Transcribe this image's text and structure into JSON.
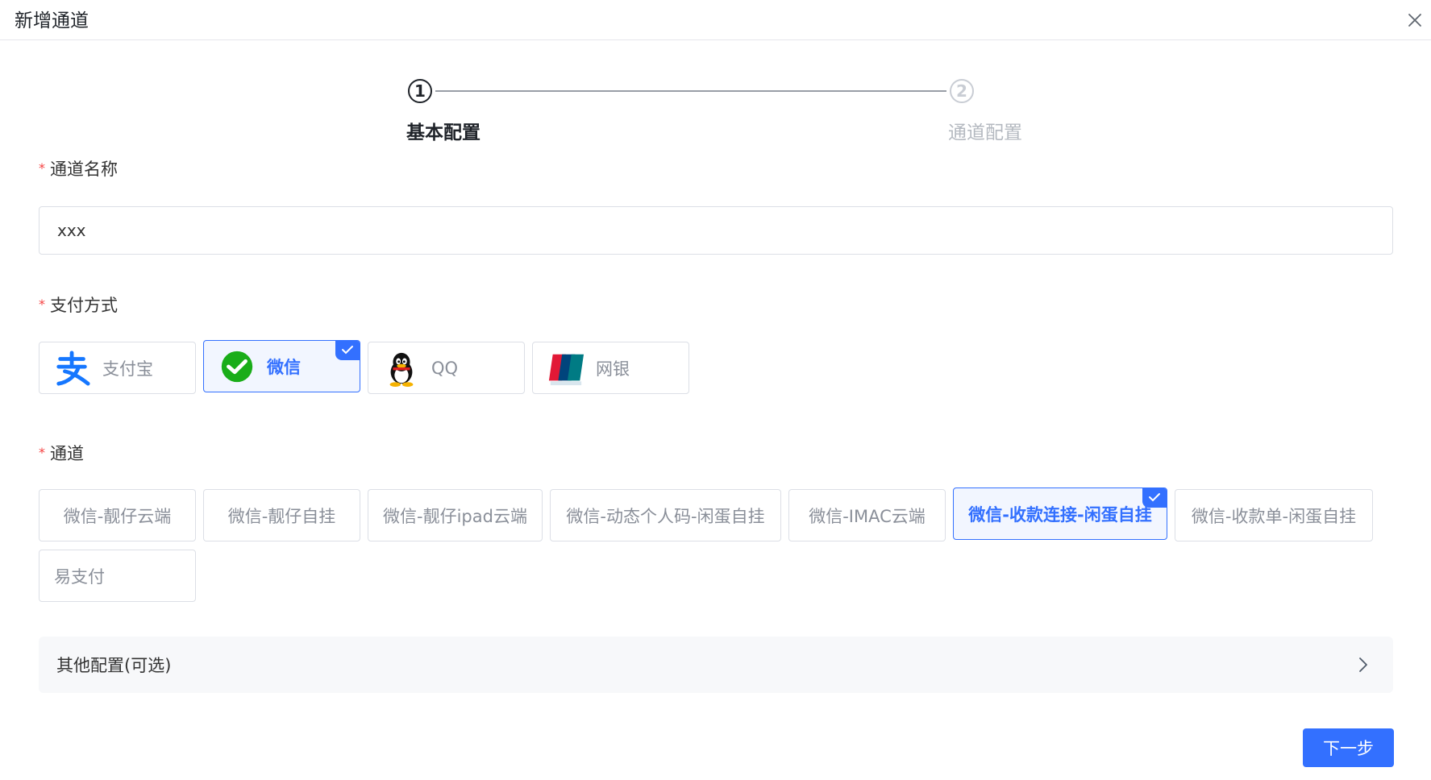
{
  "dialog": {
    "title": "新增通道"
  },
  "steps": [
    {
      "number": "1",
      "label": "基本配置"
    },
    {
      "number": "2",
      "label": "通道配置"
    }
  ],
  "form": {
    "name_label": "通道名称",
    "name_value": "xxx",
    "payment_label": "支付方式",
    "payment_methods": [
      {
        "label": "支付宝",
        "icon": "alipay-icon",
        "selected": false
      },
      {
        "label": "微信",
        "icon": "wechat-icon",
        "selected": true
      },
      {
        "label": "QQ",
        "icon": "qq-icon",
        "selected": false
      },
      {
        "label": "网银",
        "icon": "unionpay-icon",
        "selected": false
      }
    ],
    "channel_label": "通道",
    "channels": [
      {
        "label": "微信-靓仔云端",
        "selected": false
      },
      {
        "label": "微信-靓仔自挂",
        "selected": false
      },
      {
        "label": "微信-靓仔ipad云端",
        "selected": false
      },
      {
        "label": "微信-动态个人码-闲蛋自挂",
        "selected": false
      },
      {
        "label": "微信-IMAC云端",
        "selected": false
      },
      {
        "label": "微信-收款连接-闲蛋自挂",
        "selected": true
      },
      {
        "label": "微信-收款单-闲蛋自挂",
        "selected": false
      },
      {
        "label": "易支付",
        "selected": false
      }
    ],
    "other_config_label": "其他配置(可选)"
  },
  "actions": {
    "next_label": "下一步"
  },
  "colors": {
    "primary": "#3370ff",
    "required": "#f53f3f",
    "wechat": "#1aad19",
    "alipay": "#1677ff"
  }
}
